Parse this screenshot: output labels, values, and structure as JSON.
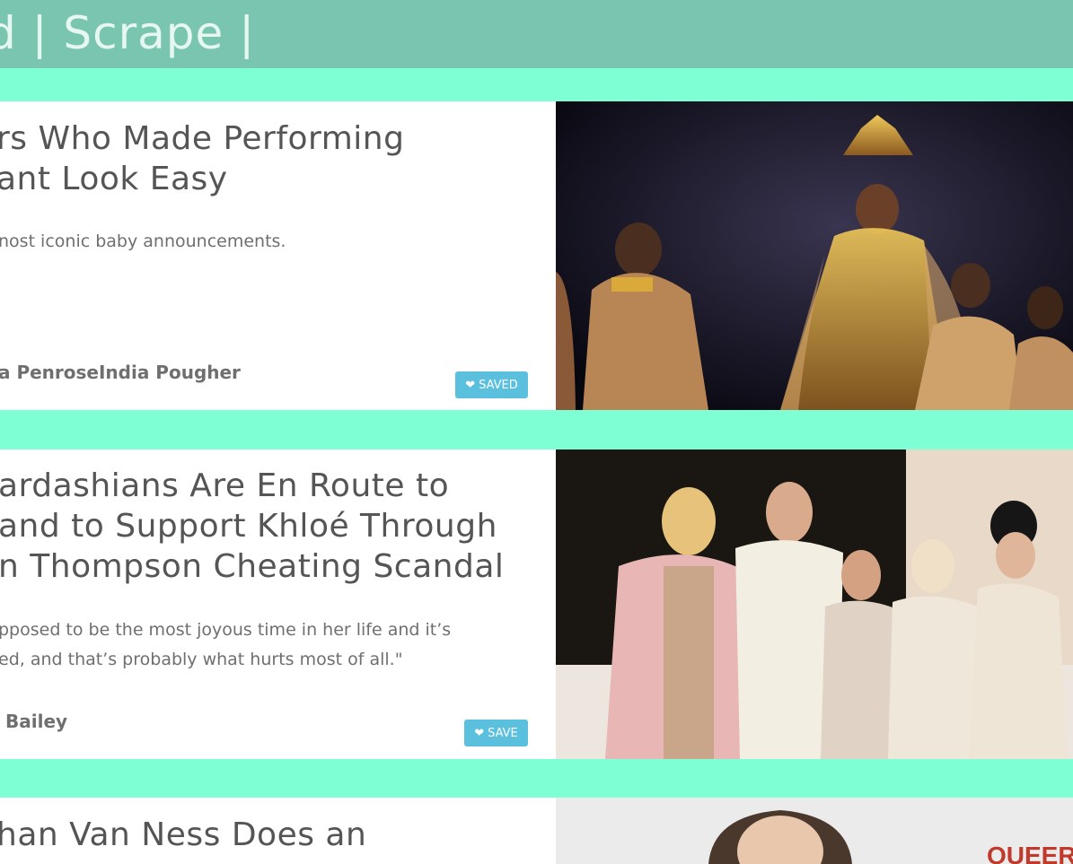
{
  "header": {
    "brand": "d | Scrape |"
  },
  "articles": [
    {
      "title_lines": [
        "rs Who Made Performing",
        "ant Look Easy"
      ],
      "summary_lines": [
        "nost iconic baby announcements."
      ],
      "author": "a PenroseIndia Pougher",
      "button": {
        "label": "SAVED",
        "icon": "heart-icon"
      },
      "image": "photo-performer-on-stage"
    },
    {
      "title_lines": [
        "ardashians Are En Route to",
        "and to Support Khloé Through",
        "n Thompson Cheating Scandal"
      ],
      "summary_lines": [
        "pposed to be the most joyous time in her life and it’s",
        "ed, and that’s probably what hurts most of all.\""
      ],
      "author": "Bailey",
      "button": {
        "label": "SAVE",
        "icon": "heart-icon"
      },
      "image": "photo-group-of-five-women"
    },
    {
      "title_lines": [
        "han Van Ness Does an"
      ],
      "image_text": "QUEER EYE",
      "image": "photo-portrait-at-event"
    }
  ],
  "colors": {
    "page_bg": "#7fffd4",
    "header_bg": "#79c5b0",
    "button_bg": "#5bc0de"
  }
}
